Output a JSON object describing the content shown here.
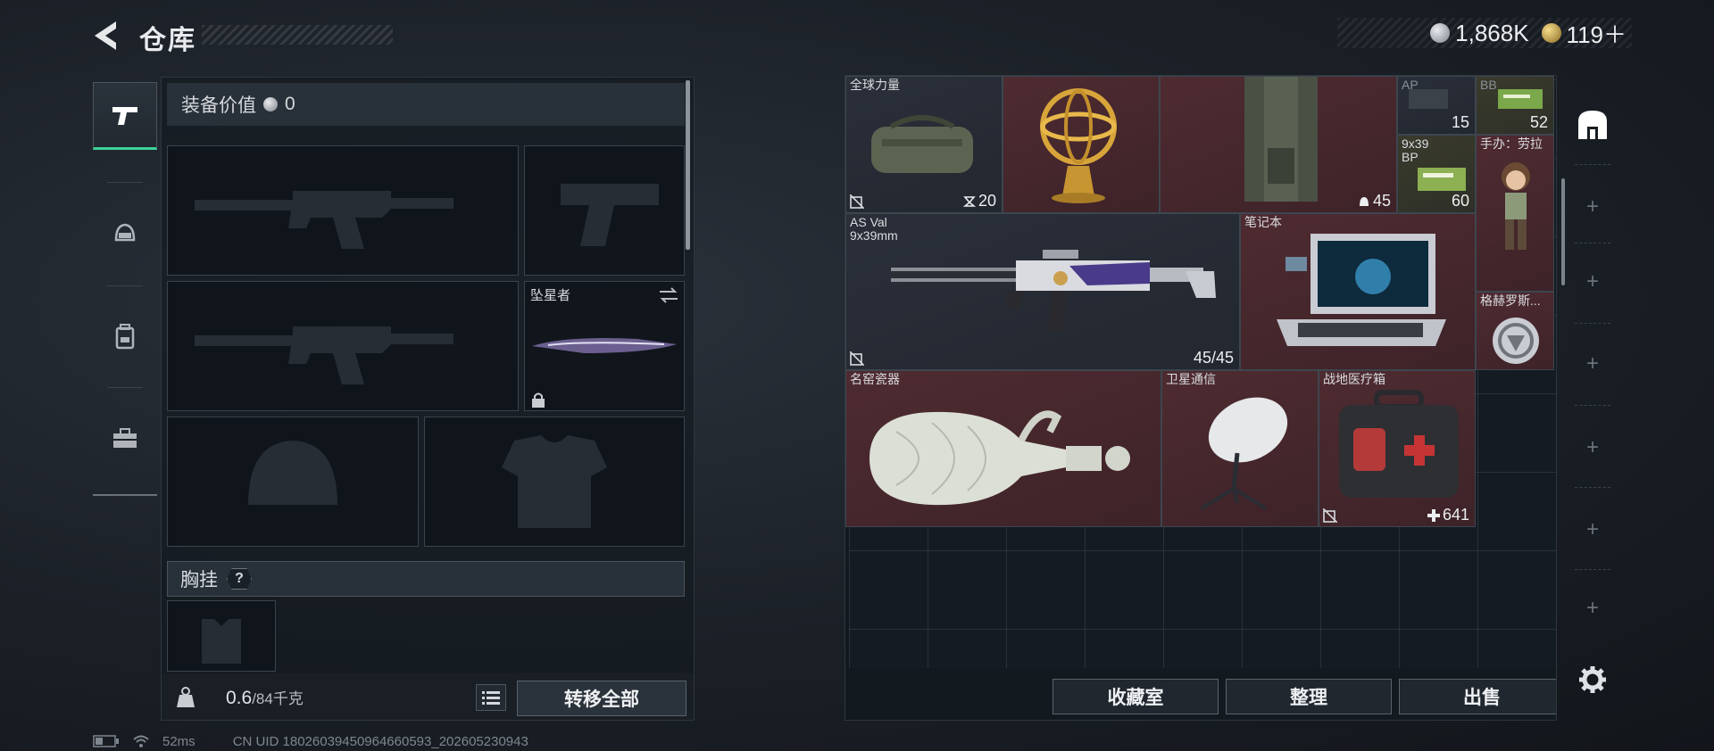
{
  "header": {
    "title": "仓库",
    "currencies": [
      {
        "icon": "silver-coin-icon",
        "value": "1,868K"
      },
      {
        "icon": "gold-coin-icon",
        "value": "119＋"
      }
    ]
  },
  "loadout": {
    "equip_value_label": "装备价值",
    "equip_value": "0",
    "melee_slot_label": "坠星者",
    "chest_rig_label": "胸挂",
    "chest_rig_help": "?",
    "weight_current": "0.6",
    "weight_max": "/84千克",
    "transfer_all_label": "转移全部"
  },
  "stash": {
    "items": [
      {
        "id": "global-force",
        "label": "全球力量",
        "count": "20"
      },
      {
        "id": "armillary",
        "label": "",
        "count": ""
      },
      {
        "id": "vest",
        "label": "",
        "count": "45"
      },
      {
        "id": "ap-ammo",
        "label": "AP",
        "count": "15"
      },
      {
        "id": "bb-ammo",
        "label": "BB",
        "count": "52"
      },
      {
        "id": "bp-ammo",
        "label": "9x39\nBP",
        "count": "60"
      },
      {
        "id": "figure",
        "label": "手办：劳拉",
        "count": ""
      },
      {
        "id": "as-val",
        "label": "AS Val\n9x39mm",
        "count": "45/45"
      },
      {
        "id": "laptop",
        "label": "笔记本",
        "count": ""
      },
      {
        "id": "hermes",
        "label": "格赫罗斯...",
        "count": ""
      },
      {
        "id": "vase",
        "label": "名窑瓷器",
        "count": ""
      },
      {
        "id": "satellite",
        "label": "卫星通信",
        "count": ""
      },
      {
        "id": "medkit",
        "label": "战地医疗箱",
        "count": "641"
      }
    ],
    "buttons": {
      "collection": "收藏室",
      "sort": "整理",
      "sell": "出售"
    }
  },
  "status": {
    "ping": "52ms",
    "uid": "CN UID 18026039450964660593_202605230943"
  },
  "colors": {
    "accent": "#3bd29a",
    "rare_red": "#4e2b31",
    "panel": "#141a20"
  }
}
